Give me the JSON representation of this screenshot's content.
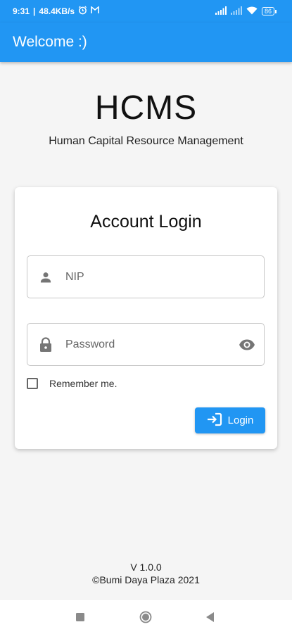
{
  "status_bar": {
    "time": "9:31",
    "network_speed": "48.4KB/s",
    "battery": "86",
    "icons": [
      "alarm-icon",
      "gmail-icon",
      "signal-icon",
      "signal-icon",
      "wifi-icon",
      "battery-icon"
    ]
  },
  "app_bar": {
    "title": "Welcome :)"
  },
  "brand": {
    "title": "HCMS",
    "subtitle": "Human Capital Resource Management"
  },
  "login_card": {
    "title": "Account Login",
    "nip_placeholder": "NIP",
    "password_placeholder": "Password",
    "remember_label": "Remember me.",
    "remember_checked": false,
    "login_label": "Login"
  },
  "footer": {
    "version": "V 1.0.0",
    "copyright": "©Bumi Daya Plaza 2021"
  },
  "colors": {
    "primary": "#2196f3",
    "background": "#f5f5f5"
  }
}
